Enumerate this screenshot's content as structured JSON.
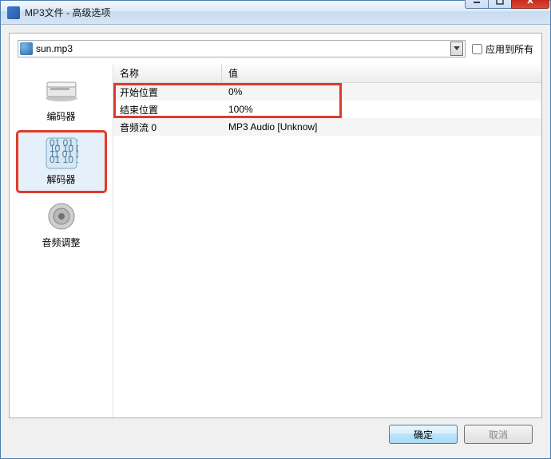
{
  "window": {
    "title": "MP3文件 - 高级选项"
  },
  "file": {
    "name": "sun.mp3"
  },
  "apply_all": {
    "label": "应用到所有",
    "checked": false
  },
  "sidebar": {
    "items": [
      {
        "label": "编码器"
      },
      {
        "label": "解码器"
      },
      {
        "label": "音频调整"
      }
    ],
    "selected_index": 1
  },
  "properties": {
    "headers": {
      "name": "名称",
      "value": "值"
    },
    "rows": [
      {
        "name": "开始位置",
        "value": "0%"
      },
      {
        "name": "结束位置",
        "value": "100%"
      },
      {
        "name": "音频流 0",
        "value": "MP3 Audio [Unknow]"
      }
    ]
  },
  "buttons": {
    "ok": "确定",
    "cancel": "取消"
  }
}
